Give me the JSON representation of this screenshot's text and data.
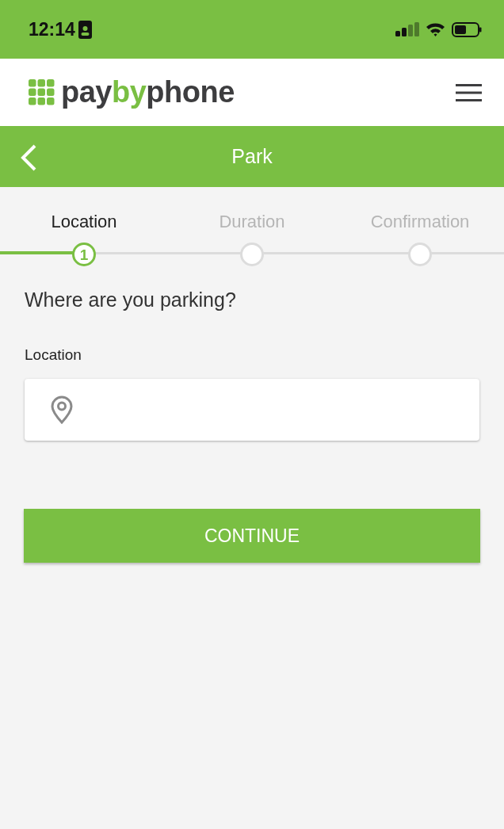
{
  "status_bar": {
    "time": "12:14"
  },
  "header": {
    "logo": [
      {
        "text": "pay",
        "accent": false
      },
      {
        "text": "by",
        "accent": true
      },
      {
        "text": "phone",
        "accent": false
      }
    ]
  },
  "title_bar": {
    "title": "Park"
  },
  "steps": [
    {
      "label": "Location",
      "selected": true,
      "number": "1"
    },
    {
      "label": "Duration",
      "selected": false
    },
    {
      "label": "Confirmation",
      "selected": false
    }
  ],
  "question": "Where are you parking?",
  "location_field": {
    "label": "Location"
  },
  "continue_button": "CONTINUE"
}
